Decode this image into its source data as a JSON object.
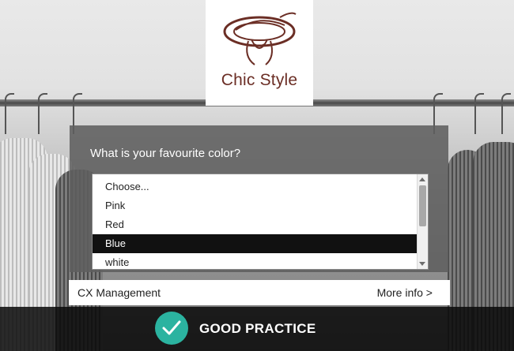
{
  "logo": {
    "text": "Chic Style",
    "icon": "woman-hat-illustration",
    "color": "#6b2e25"
  },
  "form": {
    "question": "What is your favourite color?",
    "options": [
      "Choose...",
      "Pink",
      "Red",
      "Blue",
      "white"
    ],
    "selected": "Blue"
  },
  "cx_bar": {
    "left_label": "CX Management",
    "right_link": "More info >"
  },
  "footer": {
    "badge_text": "GOOD PRACTICE",
    "badge_icon": "checkmark-icon",
    "badge_color": "#2bb3a0"
  }
}
